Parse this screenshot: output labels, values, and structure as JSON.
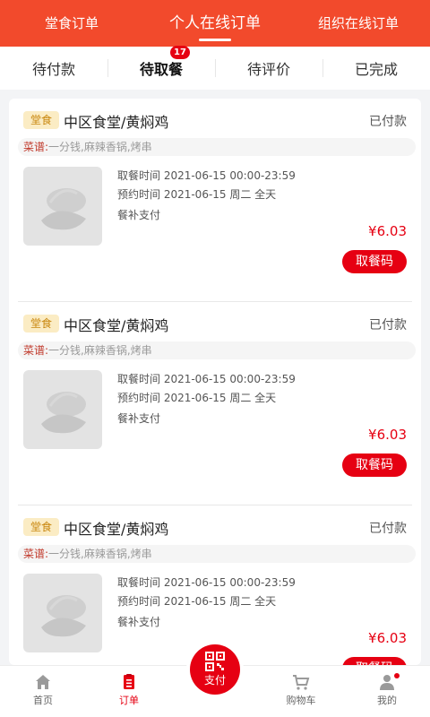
{
  "top_tabs": [
    {
      "label": "堂食订单"
    },
    {
      "label": "个人在线订单"
    },
    {
      "label": "组织在线订单"
    }
  ],
  "sub_tabs": [
    {
      "label": "待付款"
    },
    {
      "label": "待取餐",
      "badge": "17"
    },
    {
      "label": "待评价"
    },
    {
      "label": "已完成"
    }
  ],
  "orders": [
    {
      "tag": "堂食",
      "shop": "中区食堂/黄焖鸡",
      "status": "已付款",
      "menu_label": "菜谱:",
      "menu_items": "一分钱,麻辣香锅,烤串",
      "pickup_time": "取餐时间 2021-06-15 00:00-23:59",
      "reserve_time": "预约时间 2021-06-15 周二 全天",
      "payment": "餐补支付",
      "price": "¥6.03",
      "button": "取餐码"
    },
    {
      "tag": "堂食",
      "shop": "中区食堂/黄焖鸡",
      "status": "已付款",
      "menu_label": "菜谱:",
      "menu_items": "一分钱,麻辣香锅,烤串",
      "pickup_time": "取餐时间 2021-06-15 00:00-23:59",
      "reserve_time": "预约时间 2021-06-15 周二 全天",
      "payment": "餐补支付",
      "price": "¥6.03",
      "button": "取餐码"
    },
    {
      "tag": "堂食",
      "shop": "中区食堂/黄焖鸡",
      "status": "已付款",
      "menu_label": "菜谱:",
      "menu_items": "一分钱,麻辣香锅,烤串",
      "pickup_time": "取餐时间 2021-06-15 00:00-23:59",
      "reserve_time": "预约时间 2021-06-15 周二 全天",
      "payment": "餐补支付",
      "price": "¥6.03",
      "button": "取餐码"
    }
  ],
  "bottom_nav": [
    {
      "label": "首页",
      "icon": "home-icon"
    },
    {
      "label": "订单",
      "icon": "order-icon"
    },
    {
      "label": "支付",
      "icon": "qr-pay-icon"
    },
    {
      "label": "购物车",
      "icon": "cart-icon"
    },
    {
      "label": "我的",
      "icon": "user-icon"
    }
  ],
  "colors": {
    "brand": "#f24a2c",
    "accent": "#e60012",
    "tag_bg": "#fbecc4",
    "tag_text": "#c8860d"
  }
}
